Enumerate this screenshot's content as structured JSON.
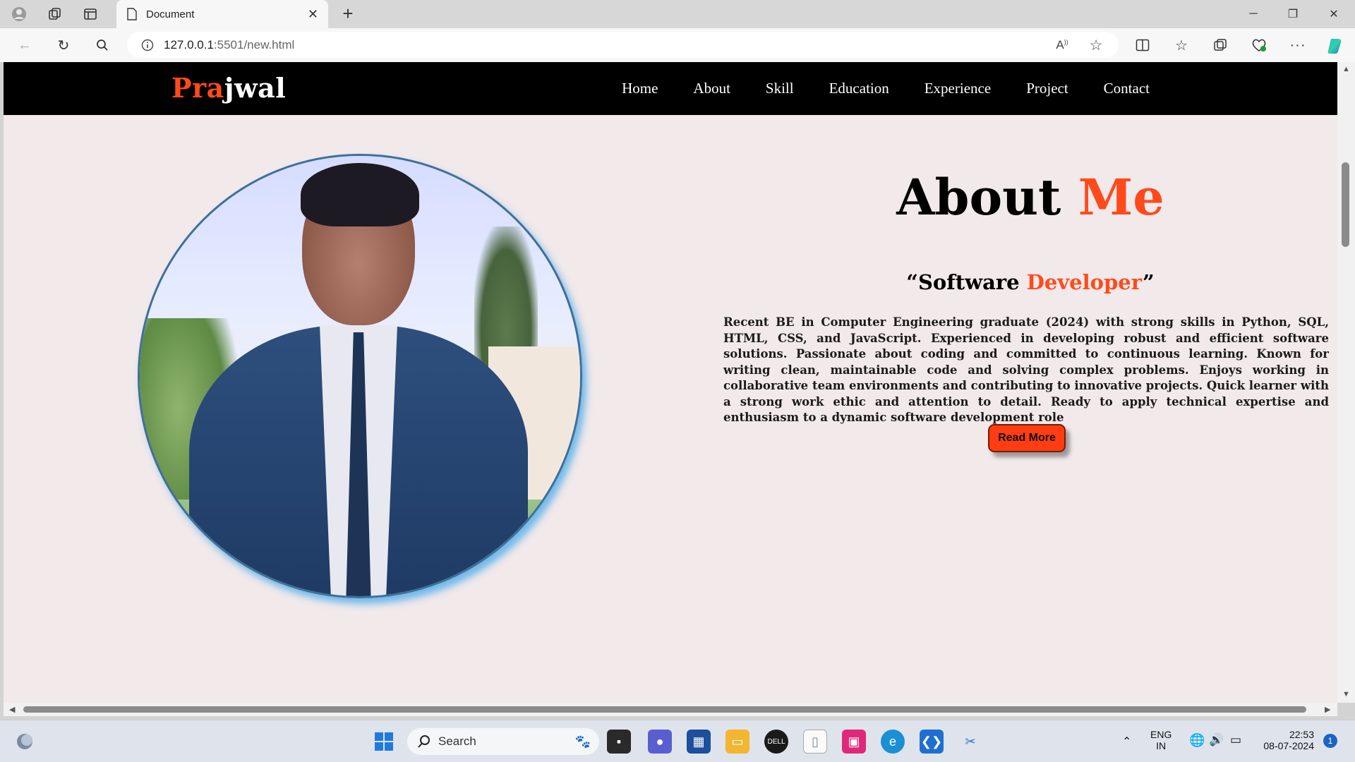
{
  "browser": {
    "tab_title": "Document",
    "url_host": "127.0.0.1",
    "url_rest": ":5501/new.html"
  },
  "site": {
    "logo_accent": "Pra",
    "logo_rest": "jwal",
    "nav": [
      "Home",
      "About",
      "Skill",
      "Education",
      "Experience",
      "Project",
      "Contact"
    ]
  },
  "about": {
    "title_main": "About",
    "title_accent": "Me",
    "role_open": "“Software",
    "role_accent": "Developer",
    "role_close": "”",
    "bio": "Recent BE in Computer Engineering graduate (2024) with strong skills in Python, SQL, HTML, CSS, and JavaScript. Experienced in developing robust and efficient software solutions. Passionate about coding and committed to continuous learning. Known for writing clean, maintainable code and solving complex problems. Enjoys working in collaborative team environments and contributing to innovative projects. Quick learner with a strong work ethic and attention to detail. Ready to apply technical expertise and enthusiasm to a dynamic software development role",
    "button": "Read More"
  },
  "taskbar": {
    "search_placeholder": "Search",
    "lang_top": "ENG",
    "lang_bottom": "IN",
    "time": "22:53",
    "date": "08-07-2024",
    "notification_count": "1"
  },
  "colors": {
    "accent": "#ff4a1c",
    "navbar": "#000000",
    "page_bg": "#f1e9ea"
  }
}
